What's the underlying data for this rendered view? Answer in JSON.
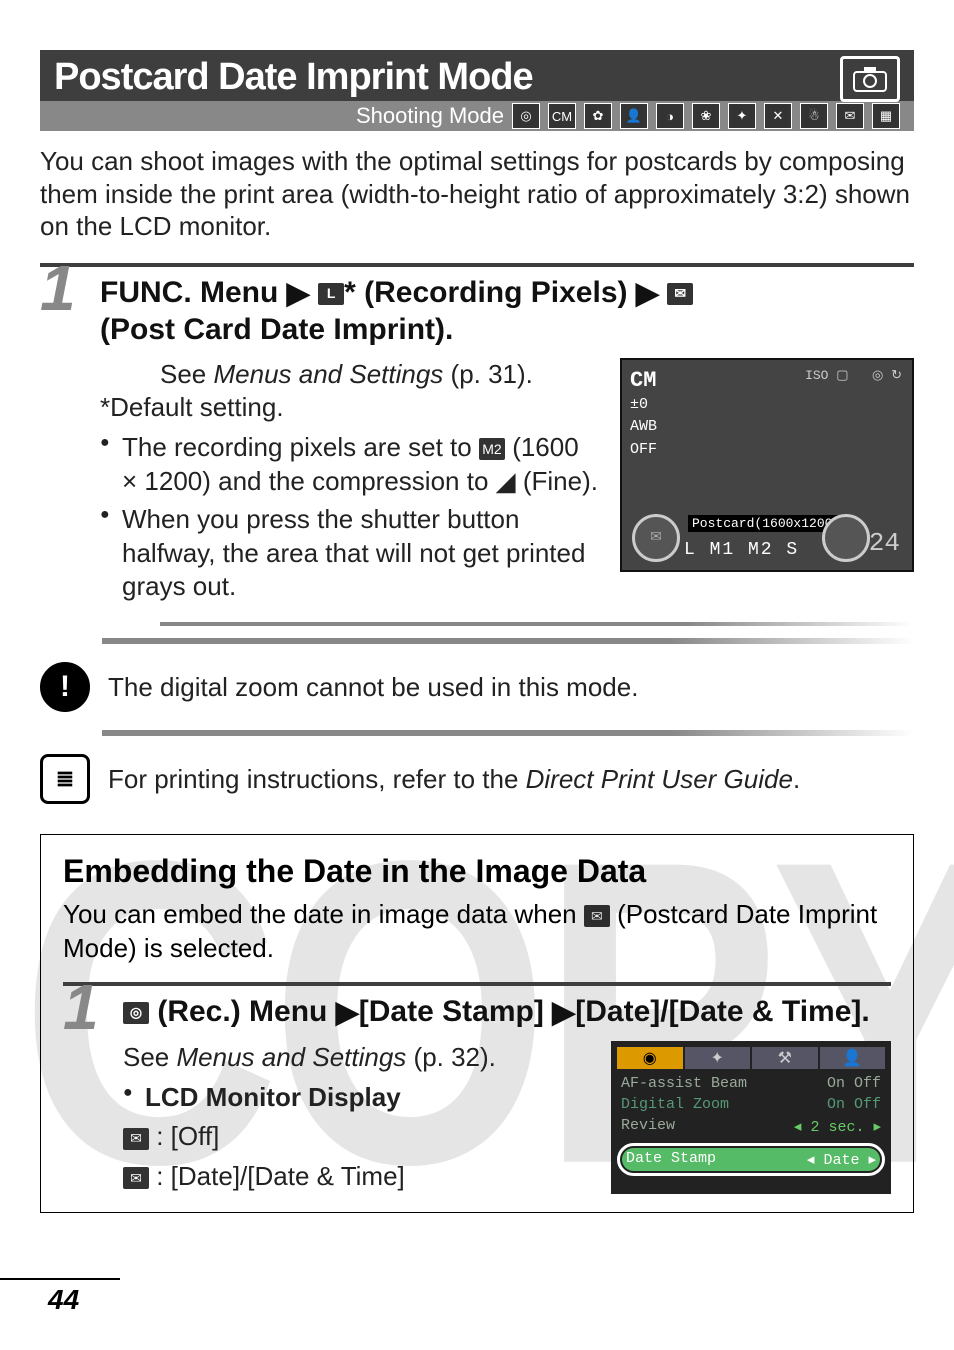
{
  "page_number": "44",
  "title_bar": {
    "title": "Postcard Date Imprint Mode"
  },
  "shooting_label": "Shooting Mode",
  "intro": "You can shoot images with the optimal settings for postcards by composing them inside the print area (width-to-height ratio of approximately 3:2) shown on the LCD monitor.",
  "step1": {
    "num": "1",
    "heading_pre": "FUNC. Menu",
    "heading_mid": "* (Recording Pixels)",
    "heading_post": "(Post Card Date Imprint).",
    "see_ref": "See ",
    "see_title": "Menus and Settings",
    "see_page": " (p. 31).",
    "default_note": "*Default setting.",
    "bullet1a": "The recording pixels are set to ",
    "bullet1_icon": "M2",
    "bullet1b": " (1600 × 1200) and the compression to ",
    "bullet1_fine": "(Fine).",
    "bullet2": "When you press the shutter button halfway, the area that will not get printed grays out."
  },
  "lcd1": {
    "topleft": "CM",
    "side": "±0\nAWB\nOFF",
    "label": "Postcard(1600x1200)",
    "row": "L  M1  M2  S",
    "right_num": "24"
  },
  "warning": "The digital zoom cannot be used in this mode.",
  "info_pre": "For printing instructions, refer to the ",
  "info_title": "Direct Print User Guide",
  "info_post": ".",
  "embed": {
    "title": "Embedding the Date in the Image Data",
    "intro_a": "You can embed the date in image data when ",
    "intro_b": " (Postcard Date Imprint Mode) is selected.",
    "step_num": "1",
    "heading": " (Rec.) Menu",
    "heading2": "[Date Stamp]",
    "heading3": "[Date]/[Date & Time].",
    "see_ref": "See ",
    "see_title": "Menus and Settings",
    "see_page": " (p. 32).",
    "lcd_label": "LCD Monitor Display",
    "off_label": ": [Off]",
    "date_label": ": [Date]/[Date & Time]"
  },
  "menu": {
    "rows": [
      {
        "l": "AF-assist Beam",
        "r": "On Off"
      },
      {
        "l": "Digital Zoom",
        "r": "On Off"
      },
      {
        "l": "Review",
        "r": "2 sec."
      },
      {
        "l": "",
        "r": ""
      },
      {
        "l": "Date Stamp",
        "r": "Date"
      }
    ]
  },
  "watermark": "COPY"
}
